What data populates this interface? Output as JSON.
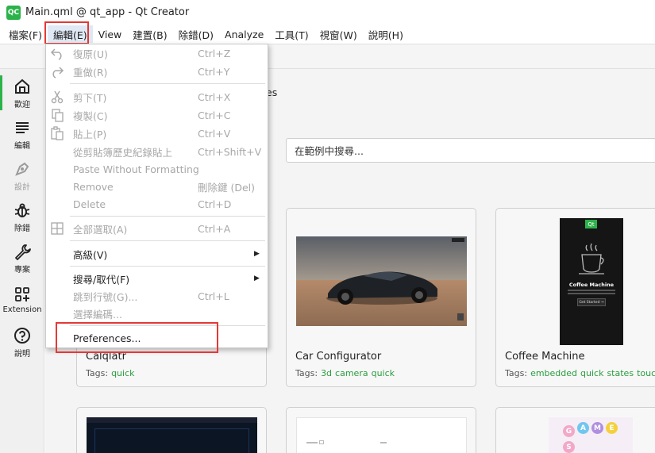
{
  "window": {
    "logo_text": "QC",
    "title": "Main.qml @ qt_app - Qt Creator"
  },
  "menubar": {
    "items": [
      "檔案(F)",
      "編輯(E)",
      "View",
      "建置(B)",
      "除錯(D)",
      "Analyze",
      "工具(T)",
      "視窗(W)",
      "說明(H)"
    ],
    "active_index": 1
  },
  "sidebar": {
    "items": [
      {
        "label": "歡迎",
        "icon": "home-icon",
        "active": true
      },
      {
        "label": "編輯",
        "icon": "edit-lines-icon"
      },
      {
        "label": "設計",
        "icon": "design-pen-icon",
        "disabled": true
      },
      {
        "label": "除錯",
        "icon": "bug-icon"
      },
      {
        "label": "專案",
        "icon": "wrench-icon"
      },
      {
        "label": "Extension",
        "icon": "extensions-icon"
      },
      {
        "label": "說明",
        "icon": "help-icon"
      }
    ]
  },
  "welcome": {
    "partial_tab_text": "es",
    "search_placeholder": "在範例中搜尋..."
  },
  "examples": [
    {
      "title": "Calqlatr",
      "tags_label": "Tags:",
      "tags": [
        "quick"
      ]
    },
    {
      "title": "Car Configurator",
      "tags_label": "Tags:",
      "tags": [
        "3d",
        "camera",
        "quick"
      ]
    },
    {
      "title": "Coffee Machine",
      "tags_label": "Tags:",
      "tags": [
        "embedded",
        "quick",
        "states",
        "touch"
      ]
    }
  ],
  "coffee_thumb": {
    "badge": "Qt",
    "heading": "Coffee Machine",
    "button": "Get Started →"
  },
  "games_thumb": {
    "letters": [
      "G",
      "A",
      "M",
      "E",
      "S"
    ]
  },
  "edit_menu": {
    "items": [
      {
        "label": "復原(U)",
        "shortcut": "Ctrl+Z",
        "disabled": true,
        "icon": "undo-icon"
      },
      {
        "label": "重做(R)",
        "shortcut": "Ctrl+Y",
        "disabled": true,
        "icon": "redo-icon"
      },
      {
        "label": "剪下(T)",
        "shortcut": "Ctrl+X",
        "disabled": true,
        "icon": "cut-icon"
      },
      {
        "label": "複製(C)",
        "shortcut": "Ctrl+C",
        "disabled": true,
        "icon": "copy-icon"
      },
      {
        "label": "貼上(P)",
        "shortcut": "Ctrl+V",
        "disabled": true,
        "icon": "paste-icon"
      },
      {
        "label": "從剪貼簿歷史紀錄貼上",
        "shortcut": "Ctrl+Shift+V",
        "disabled": true
      },
      {
        "label": "Paste Without Formatting",
        "shortcut": "",
        "disabled": true
      },
      {
        "label": "Remove",
        "shortcut": "刪除鍵 (Del)",
        "disabled": true
      },
      {
        "label": "Delete",
        "shortcut": "Ctrl+D",
        "disabled": true
      },
      {
        "label": "全部選取(A)",
        "shortcut": "Ctrl+A",
        "disabled": true,
        "icon": "select-all-icon"
      },
      {
        "label": "高級(V)",
        "shortcut": "",
        "submenu": true
      },
      {
        "label": "搜尋/取代(F)",
        "shortcut": "",
        "submenu": true
      },
      {
        "label": "跳到行號(G)...",
        "shortcut": "Ctrl+L",
        "disabled": true
      },
      {
        "label": "選擇編碼...",
        "shortcut": "",
        "disabled": true
      },
      {
        "label": "Preferences...",
        "shortcut": ""
      }
    ]
  },
  "colors": {
    "accent_green": "#2cb24a",
    "highlight_red": "#e53935",
    "tag_green": "#2a9d3e"
  }
}
